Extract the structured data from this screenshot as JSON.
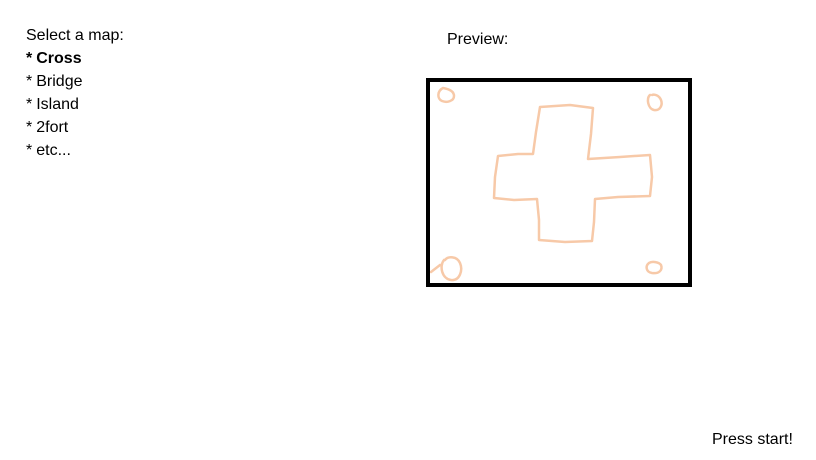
{
  "map_select": {
    "heading": "Select a map:",
    "bullet": "*",
    "maps": [
      {
        "label": "Cross",
        "selected": true
      },
      {
        "label": "Bridge",
        "selected": false
      },
      {
        "label": "Island",
        "selected": false
      },
      {
        "label": "2fort",
        "selected": false
      },
      {
        "label": "etc...",
        "selected": false
      }
    ]
  },
  "preview": {
    "label": "Preview:",
    "sketch_color": "#f7c9a8",
    "frame_color": "#000000"
  },
  "footer": {
    "start_label": "Press start!"
  }
}
